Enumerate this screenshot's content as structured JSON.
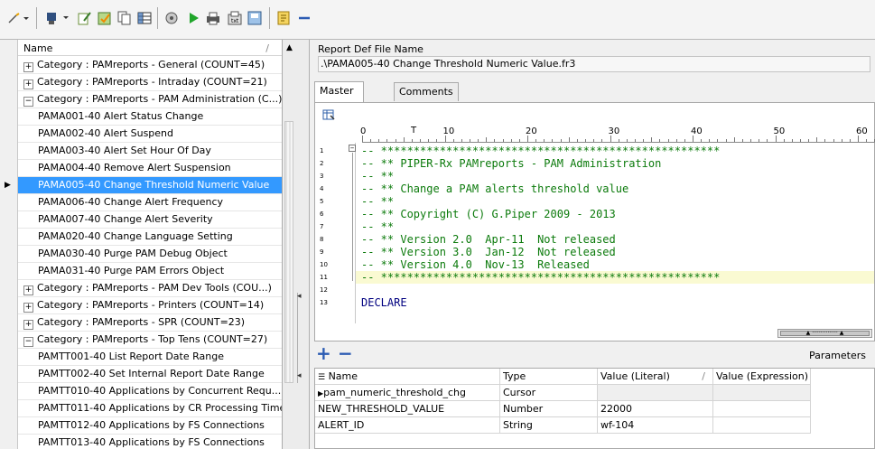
{
  "toolbar": {
    "icons": [
      "wand-dropdown-icon",
      "robot-dropdown-icon",
      "edit-report-icon",
      "edit-check-icon",
      "copy-icon",
      "table-icon",
      "wizard-icon",
      "run-icon",
      "print-icon",
      "export-icon",
      "save-icon",
      "document-icon",
      "minus-icon"
    ]
  },
  "tree": {
    "header": "Name",
    "sort_mark": "/",
    "rows": [
      {
        "type": "cat",
        "expander": "+",
        "label": "Category : PAMreports - General (COUNT=45)"
      },
      {
        "type": "cat",
        "expander": "+",
        "label": "Category : PAMreports - Intraday (COUNT=21)"
      },
      {
        "type": "cat",
        "expander": "−",
        "label": "Category : PAMreports - PAM Administration (C...)"
      },
      {
        "type": "item",
        "label": "PAMA001-40 Alert Status Change"
      },
      {
        "type": "item",
        "label": "PAMA002-40 Alert Suspend"
      },
      {
        "type": "item",
        "label": "PAMA003-40 Alert Set Hour Of Day"
      },
      {
        "type": "item",
        "label": "PAMA004-40 Remove Alert Suspension"
      },
      {
        "type": "item",
        "label": "PAMA005-40 Change Threshold Numeric Value",
        "selected": true
      },
      {
        "type": "item",
        "label": "PAMA006-40 Change Alert Frequency"
      },
      {
        "type": "item",
        "label": "PAMA007-40 Change Alert Severity"
      },
      {
        "type": "item",
        "label": "PAMA020-40 Change Language Setting"
      },
      {
        "type": "item",
        "label": "PAMA030-40 Purge PAM Debug Object"
      },
      {
        "type": "item",
        "label": "PAMA031-40 Purge PAM Errors Object"
      },
      {
        "type": "cat",
        "expander": "+",
        "label": "Category : PAMreports - PAM Dev Tools (COU...)"
      },
      {
        "type": "cat",
        "expander": "+",
        "label": "Category : PAMreports - Printers (COUNT=14)"
      },
      {
        "type": "cat",
        "expander": "+",
        "label": "Category : PAMreports - SPR (COUNT=23)"
      },
      {
        "type": "cat",
        "expander": "−",
        "label": "Category : PAMreports - Top Tens (COUNT=27)"
      },
      {
        "type": "item",
        "label": "PAMTT001-40 List Report Date Range"
      },
      {
        "type": "item",
        "label": "PAMTT002-40 Set Internal Report Date Range"
      },
      {
        "type": "item",
        "label": "PAMTT010-40 Applications by Concurrent Requ..."
      },
      {
        "type": "item",
        "label": "PAMTT011-40 Applications by CR Processing Time"
      },
      {
        "type": "item",
        "label": "PAMTT012-40 Applications by FS Connections"
      },
      {
        "type": "item",
        "label": "PAMTT013-40 Applications by FS Connections"
      }
    ]
  },
  "report_def": {
    "label": "Report Def File Name",
    "value": ".\\PAMA005-40 Change Threshold Numeric Value.fr3"
  },
  "tabs": [
    {
      "label": "Master Dataset",
      "active": true
    },
    {
      "label": "Comments",
      "active": false
    }
  ],
  "ruler": {
    "numbers": [
      "0",
      "10",
      "20",
      "30",
      "40",
      "50",
      "60"
    ],
    "cursor_mark": "T"
  },
  "editor": {
    "lines": [
      {
        "n": "1",
        "text": "-- ****************************************************"
      },
      {
        "n": "2",
        "text": "-- ** PIPER-Rx PAMreports - PAM Administration"
      },
      {
        "n": "3",
        "text": "-- **"
      },
      {
        "n": "4",
        "text": "-- ** Change a PAM alerts threshold value"
      },
      {
        "n": "5",
        "text": "-- **"
      },
      {
        "n": "6",
        "text": "-- ** Copyright (C) G.Piper 2009 - 2013"
      },
      {
        "n": "7",
        "text": "-- **"
      },
      {
        "n": "8",
        "text": "-- ** Version 2.0  Apr-11  Not released"
      },
      {
        "n": "9",
        "text": "-- ** Version 3.0  Jan-12  Not released"
      },
      {
        "n": "10",
        "text": "-- ** Version 4.0  Nov-13  Released"
      },
      {
        "n": "11",
        "text": "-- ****************************************************"
      },
      {
        "n": "12",
        "text": ""
      },
      {
        "n": "13",
        "text": "DECLARE"
      }
    ],
    "highlight_line": 11
  },
  "params": {
    "add_label": "+",
    "remove_label": "−",
    "title": "Parameters",
    "columns": [
      "Name",
      "Type",
      "Value (Literal)",
      "Value (Expression)"
    ],
    "rows": [
      {
        "name": "pam_numeric_threshold_chg",
        "type": "Cursor",
        "literal": "",
        "expression": "",
        "current": true
      },
      {
        "name": "NEW_THRESHOLD_VALUE",
        "type": "Number",
        "literal": "22000",
        "expression": ""
      },
      {
        "name": "ALERT_ID",
        "type": "String",
        "literal": "wf-104",
        "expression": ""
      }
    ]
  }
}
